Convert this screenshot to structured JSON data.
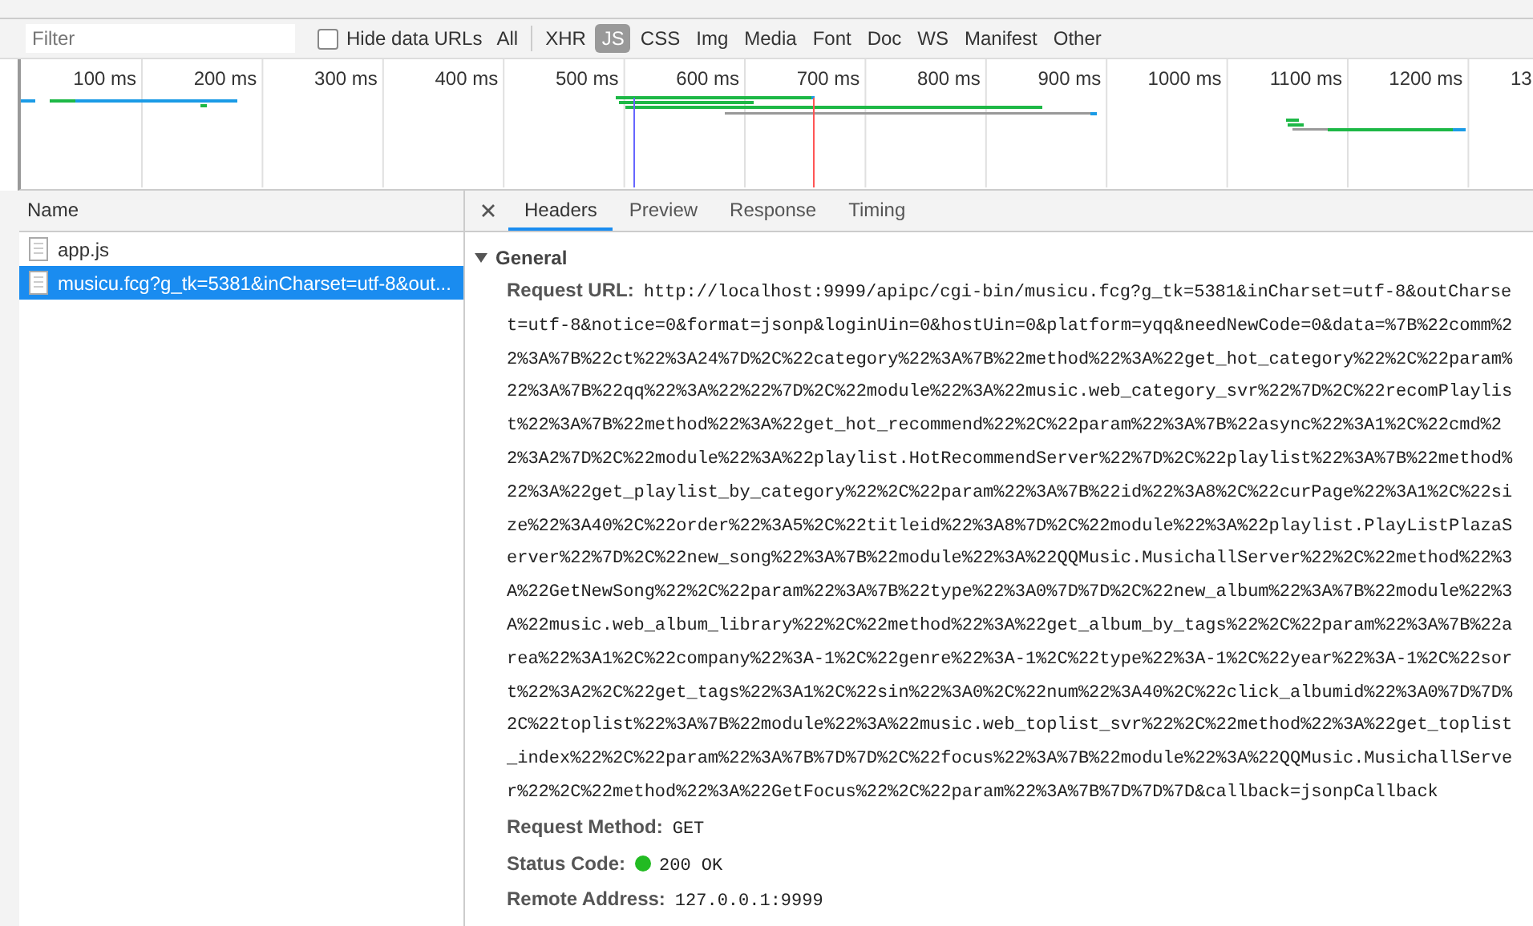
{
  "filter_bar": {
    "placeholder": "Filter",
    "hide_data_urls": {
      "label": "Hide data URLs",
      "checked": false
    },
    "types": [
      {
        "label": "All",
        "selected": false
      },
      {
        "label": "XHR",
        "selected": false
      },
      {
        "label": "JS",
        "selected": true
      },
      {
        "label": "CSS",
        "selected": false
      },
      {
        "label": "Img",
        "selected": false
      },
      {
        "label": "Media",
        "selected": false
      },
      {
        "label": "Font",
        "selected": false
      },
      {
        "label": "Doc",
        "selected": false
      },
      {
        "label": "WS",
        "selected": false
      },
      {
        "label": "Manifest",
        "selected": false
      },
      {
        "label": "Other",
        "selected": false
      }
    ]
  },
  "timeline": {
    "ticks": [
      "100 ms",
      "200 ms",
      "300 ms",
      "400 ms",
      "500 ms",
      "600 ms",
      "700 ms",
      "800 ms",
      "900 ms",
      "1000 ms",
      "1100 ms",
      "1200 ms",
      "13"
    ]
  },
  "requests": {
    "column": "Name",
    "items": [
      {
        "name": "app.js",
        "selected": false
      },
      {
        "name": "musicu.fcg?g_tk=5381&inCharset=utf-8&out...",
        "selected": true
      }
    ]
  },
  "details": {
    "tabs": [
      {
        "label": "Headers",
        "selected": true
      },
      {
        "label": "Preview",
        "selected": false
      },
      {
        "label": "Response",
        "selected": false
      },
      {
        "label": "Timing",
        "selected": false
      }
    ],
    "section": {
      "title": "General",
      "expanded": true,
      "fields": [
        {
          "label": "Request URL:",
          "value": "http://localhost:9999/apipc/cgi-bin/musicu.fcg?g_tk=5381&inCharset=utf-8&outCharset=utf-8&notice=0&format=jsonp&loginUin=0&hostUin=0&platform=yqq&needNewCode=0&data=%7B%22comm%22%3A%7B%22ct%22%3A24%7D%2C%22category%22%3A%7B%22method%22%3A%22get_hot_category%22%2C%22param%22%3A%7B%22qq%22%3A%22%22%7D%2C%22module%22%3A%22music.web_category_svr%22%7D%2C%22recomPlaylist%22%3A%7B%22method%22%3A%22get_hot_recommend%22%2C%22param%22%3A%7B%22async%22%3A1%2C%22cmd%22%3A2%7D%2C%22module%22%3A%22playlist.HotRecommendServer%22%7D%2C%22playlist%22%3A%7B%22method%22%3A%22get_playlist_by_category%22%2C%22param%22%3A%7B%22id%22%3A8%2C%22curPage%22%3A1%2C%22size%22%3A40%2C%22order%22%3A5%2C%22titleid%22%3A8%7D%2C%22module%22%3A%22playlist.PlayListPlazaServer%22%7D%2C%22new_song%22%3A%7B%22module%22%3A%22QQMusic.MusichallServer%22%2C%22method%22%3A%22GetNewSong%22%2C%22param%22%3A%7B%22type%22%3A0%7D%7D%2C%22new_album%22%3A%7B%22module%22%3A%22music.web_album_library%22%2C%22method%22%3A%22get_album_by_tags%22%2C%22param%22%3A%7B%22area%22%3A1%2C%22company%22%3A-1%2C%22genre%22%3A-1%2C%22type%22%3A-1%2C%22year%22%3A-1%2C%22sort%22%3A2%2C%22get_tags%22%3A1%2C%22sin%22%3A0%2C%22num%22%3A40%2C%22click_albumid%22%3A0%7D%7D%2C%22toplist%22%3A%7B%22module%22%3A%22music.web_toplist_svr%22%2C%22method%22%3A%22get_toplist_index%22%2C%22param%22%3A%7B%7D%7D%2C%22focus%22%3A%7B%22module%22%3A%22QQMusic.MusichallServer%22%2C%22method%22%3A%22GetFocus%22%2C%22param%22%3A%7B%7D%7D%7D&callback=jsonpCallback",
          "kind": "text"
        },
        {
          "label": "Request Method:",
          "value": "GET",
          "kind": "text"
        },
        {
          "label": "Status Code:",
          "value": "200 OK",
          "kind": "status",
          "color": "#22bb22"
        },
        {
          "label": "Remote Address:",
          "value": "127.0.0.1:9999",
          "kind": "text"
        }
      ]
    }
  }
}
